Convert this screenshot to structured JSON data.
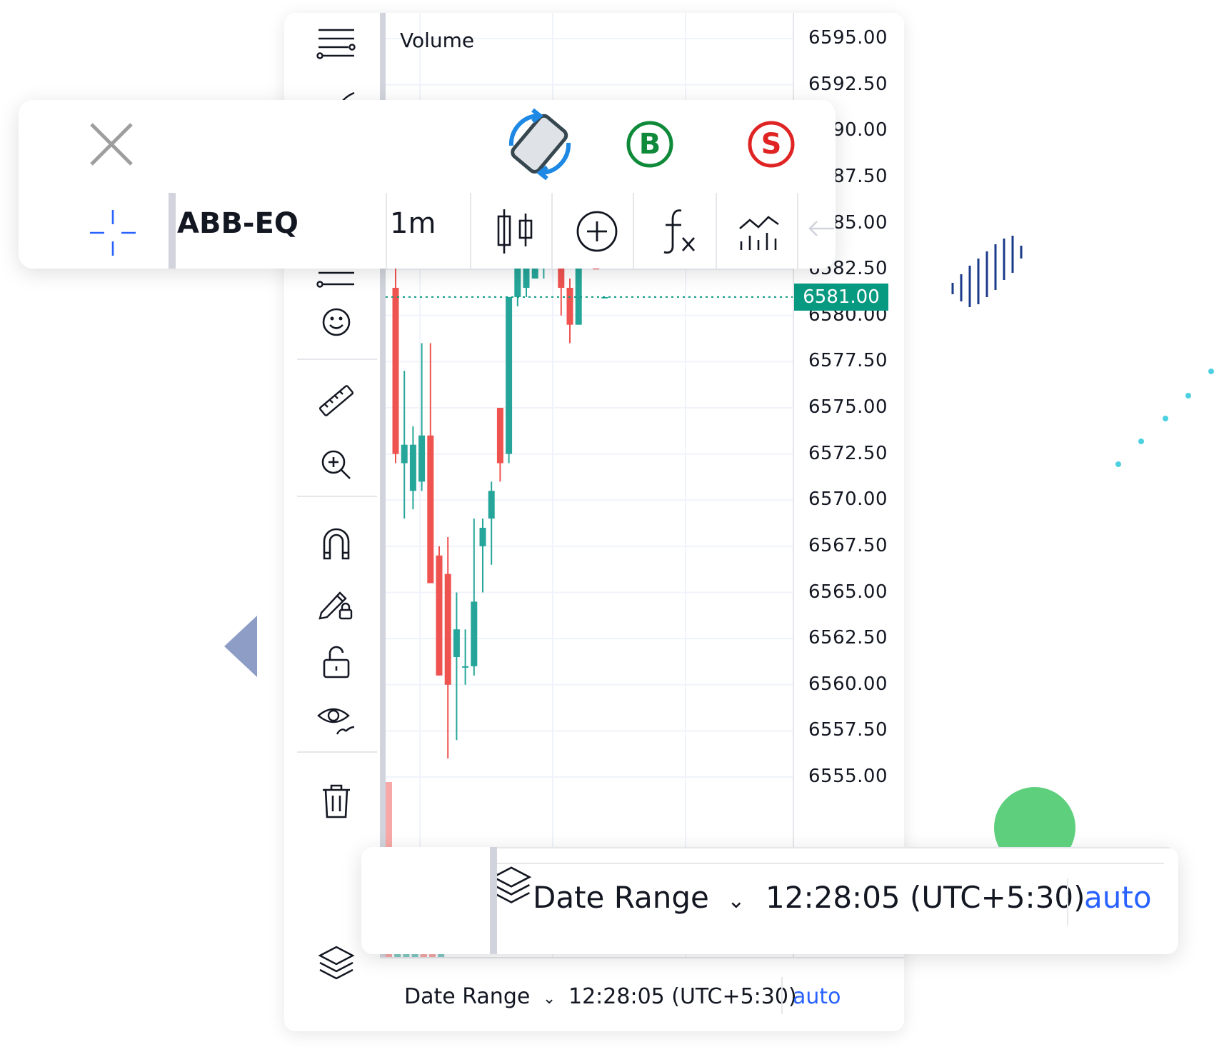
{
  "chart_panel": {
    "volume_label": "Volume",
    "price_axis": {
      "ticks": [
        "6595.00",
        "6592.50",
        "6590.00",
        "6587.50",
        "6585.00",
        "6582.50",
        "6580.00",
        "6577.50",
        "6575.00",
        "6572.50",
        "6570.00",
        "6567.50",
        "6565.00",
        "6562.50",
        "6560.00",
        "6557.50",
        "6555.00"
      ],
      "current_price": "6581.00"
    },
    "bottom_bar": {
      "date_range_label": "Date Range",
      "time": "12:28:05 (UTC+5:30)",
      "auto_label": "auto"
    },
    "left_tools": [
      "lines-tool-icon",
      "brush-icon",
      "node-line-icon",
      "emoji-icon",
      "ruler-icon",
      "zoom-in-icon",
      "magnet-icon",
      "draw-lock-icon",
      "lock-icon",
      "eye-icon",
      "trash-icon",
      "layers-icon"
    ]
  },
  "top_toolbar": {
    "close_icon": "close-icon",
    "rotate_icon": "rotate-device-icon",
    "buy_label": "B",
    "sell_label": "S",
    "crosshair_icon": "crosshair-icon",
    "symbol": "ABB-EQ",
    "interval": "1m",
    "chart_type_icon": "candles-icon",
    "compare_icon": "add-symbol-icon",
    "indicators_icon": "fx-icon",
    "templates_icon": "chart-templates-icon",
    "undo_icon": "undo-icon"
  },
  "bottom_toolbar": {
    "date_range_label": "Date Range",
    "time": "12:28:05 (UTC+5:30)",
    "auto_label": "auto"
  },
  "colors": {
    "up": "#26a69a",
    "down": "#ef5350",
    "price_tag": "#089981",
    "buy": "#0f8a3a",
    "sell": "#e02424",
    "accent": "#2962ff",
    "rotate": "#1e88e5"
  },
  "chart_data": {
    "type": "candlestick",
    "x_unit": "1m",
    "y_range": [
      6555.0,
      6595.0
    ],
    "series": [
      {
        "open": 6581.5,
        "high": 6583.0,
        "low": 6572.0,
        "close": 6572.5
      },
      {
        "open": 6572.0,
        "high": 6577.0,
        "low": 6569.0,
        "close": 6573.0
      },
      {
        "open": 6570.5,
        "high": 6574.0,
        "low": 6569.5,
        "close": 6573.0
      },
      {
        "open": 6571.0,
        "high": 6578.5,
        "low": 6570.5,
        "close": 6573.5
      },
      {
        "open": 6573.5,
        "high": 6578.5,
        "low": 6569.5,
        "close": 6565.5
      },
      {
        "open": 6567.0,
        "high": 6567.5,
        "low": 6560.5,
        "close": 6560.5
      },
      {
        "open": 6566.0,
        "high": 6568.0,
        "low": 6556.0,
        "close": 6560.0
      },
      {
        "open": 6561.5,
        "high": 6565.0,
        "low": 6557.0,
        "close": 6563.0
      },
      {
        "open": 6561.0,
        "high": 6563.0,
        "low": 6560.0,
        "close": 6561.0
      },
      {
        "open": 6561.0,
        "high": 6569.0,
        "low": 6560.5,
        "close": 6564.5
      },
      {
        "open": 6567.5,
        "high": 6569.0,
        "low": 6565.0,
        "close": 6568.5
      },
      {
        "open": 6569.0,
        "high": 6571.0,
        "low": 6566.5,
        "close": 6570.5
      },
      {
        "open": 6575.0,
        "high": 6575.0,
        "low": 6571.0,
        "close": 6572.0
      },
      {
        "open": 6572.5,
        "high": 6581.0,
        "low": 6572.0,
        "close": 6581.0
      },
      {
        "open": 6581.0,
        "high": 6583.0,
        "low": 6580.5,
        "close": 6583.0
      },
      {
        "open": 6581.5,
        "high": 6585.5,
        "low": 6581.0,
        "close": 6584.0
      },
      {
        "open": 6582.0,
        "high": 6586.0,
        "low": 6582.0,
        "close": 6584.5
      },
      {
        "open": 6583.0,
        "high": 6586.5,
        "low": 6582.0,
        "close": 6586.5
      },
      {
        "open": 6584.0,
        "high": 6587.0,
        "low": 6583.0,
        "close": 6586.0
      },
      {
        "open": 6583.5,
        "high": 6583.5,
        "low": 6580.0,
        "close": 6581.5
      },
      {
        "open": 6581.5,
        "high": 6582.0,
        "low": 6578.5,
        "close": 6579.5
      },
      {
        "open": 6579.5,
        "high": 6585.0,
        "low": 6579.5,
        "close": 6585.0
      },
      {
        "open": 6584.5,
        "high": 6586.0,
        "low": 6583.0,
        "close": 6583.5
      },
      {
        "open": 6584.5,
        "high": 6585.0,
        "low": 6582.5,
        "close": 6582.5
      },
      {
        "open": 6581.0,
        "high": 6581.0,
        "low": 6581.0,
        "close": 6581.0
      }
    ],
    "volume_bars": [
      {
        "value": 0.35,
        "up": false
      },
      {
        "value": 0.1,
        "up": true
      },
      {
        "value": 0.12,
        "up": true
      },
      {
        "value": 0.12,
        "up": true
      },
      {
        "value": 0.06,
        "up": false
      },
      {
        "value": 0.13,
        "up": false
      },
      {
        "value": 0.03,
        "up": true
      }
    ]
  }
}
